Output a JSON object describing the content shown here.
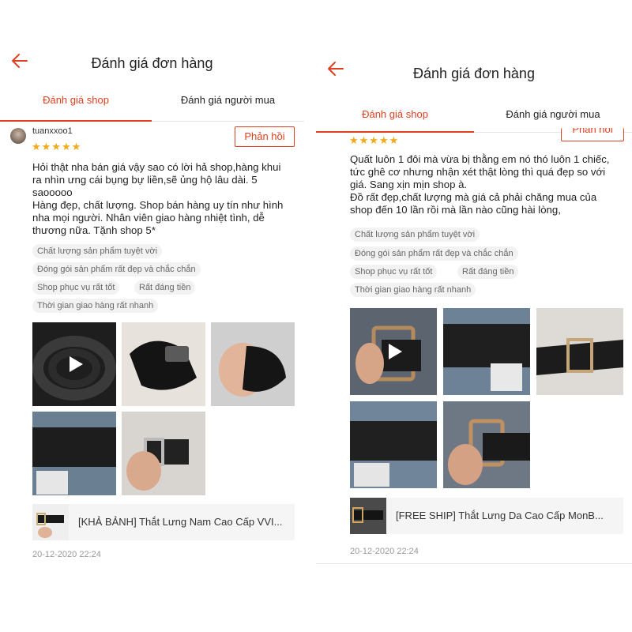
{
  "left": {
    "header": {
      "title": "Đánh giá đơn hàng",
      "back_icon": "arrow-left-icon"
    },
    "tabs": [
      {
        "label": "Đánh giá shop",
        "active": true
      },
      {
        "label": "Đánh giá người mua",
        "active": false
      }
    ],
    "review": {
      "username": "tuanxxoo1",
      "stars": "★★★★★",
      "reply_label": "Phản hồi",
      "comment": [
        "Hỏi thật nha bán giá vậy sao có lời hả shop,hàng khui",
        "ra nhìn ưng cái bụng bự liền,sẽ ủng hộ lâu dài. 5",
        "saooooo",
        "Hàng đẹp, chất lượng. Shop bán hàng uy tín như hình",
        "nha mọi người. Nhân viên giao hàng nhiệt tình, dễ",
        "thương nữa. Tặnh shop 5*"
      ],
      "tags": [
        "Chất lượng sản phẩm tuyệt vời",
        "Đóng gói sản phẩm rất đẹp và chắc chắn",
        "Shop phục vụ rất tốt",
        "Rất đáng tiền",
        "Thời gian giao hàng rất nhanh"
      ],
      "product_name": "[KHẢ BẢNH] Thắt Lưng Nam Cao Cấp VVI...",
      "date": "20-12-2020 22:24"
    }
  },
  "right": {
    "header": {
      "title": "Đánh giá đơn hàng",
      "back_icon": "arrow-left-icon"
    },
    "tabs": [
      {
        "label": "Đánh giá shop",
        "active": true
      },
      {
        "label": "Đánh giá người mua",
        "active": false
      }
    ],
    "review": {
      "stars": "★★★★★",
      "reply_label": "Phản hồi",
      "comment": [
        "Quất luôn 1 đôi mà vừa bị thằng em nó thó luôn 1 chiếc,",
        "tức ghê cơ nhưng nhận xét thật lòng thì quá đẹp so với",
        "giá. Sang xịn mịn shop à.",
        "Đồ rất đẹp,chất lượng mà giá cả phải chăng mua của",
        "shop đến 10 lần rồi mà lần nào cũng hài lòng,"
      ],
      "tags": [
        "Chất lượng sản phẩm tuyệt vời",
        "Đóng gói sản phẩm rất đẹp và chắc chắn",
        "Shop phục vụ rất tốt",
        "Rất đáng tiền",
        "Thời gian giao hàng rất nhanh"
      ],
      "product_name": "[FREE SHIP] Thắt Lưng Da Cao Cấp MonB...",
      "date": "20-12-2020 22:24"
    }
  },
  "colors": {
    "accent": "#e0401f",
    "star": "#f0a91a",
    "tag_bg": "#f2f2f2"
  }
}
